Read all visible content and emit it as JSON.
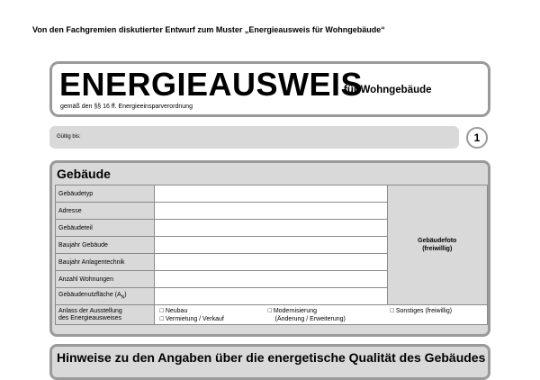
{
  "header_note": "Von den Fachgremien diskutierter Entwurf zum Muster „Energieausweis für Wohngebäude“",
  "title": {
    "main": "ENERGIEAUSWEIS",
    "sub": "für Wohngebäude",
    "legal": "gemäß den §§ 16 ff. Energieeinsparverordnung"
  },
  "validity_label": "Gültig bis:",
  "page_number": "1",
  "section_building": {
    "title": "Gebäude",
    "rows": [
      {
        "label": "Gebäudetyp"
      },
      {
        "label": "Adresse"
      },
      {
        "label": "Gebäudeteil"
      },
      {
        "label": "Baujahr Gebäude"
      },
      {
        "label": "Baujahr Anlagentechnik"
      },
      {
        "label": "Anzahl Wohnungen"
      },
      {
        "label": "Gebäudenutzfläche (A",
        "sub": "N",
        "suffix": ")"
      }
    ],
    "photo_label_1": "Gebäudefoto",
    "photo_label_2": "(freiwillig)",
    "reason_label_1": "Anlass der Ausstellung",
    "reason_label_2": "des Energieausweises",
    "options": {
      "neubau": "□ Neubau",
      "vermietung": "□ Vermietung / Verkauf",
      "modernisierung": "□ Modernisierung",
      "modernisierung_detail": "(Änderung / Erweiterung)",
      "sonstiges": "□ Sonstiges (freiwillig)"
    }
  },
  "section_notes": {
    "title": "Hinweise zu den Angaben über die energetische Qualität des Gebäudes"
  }
}
